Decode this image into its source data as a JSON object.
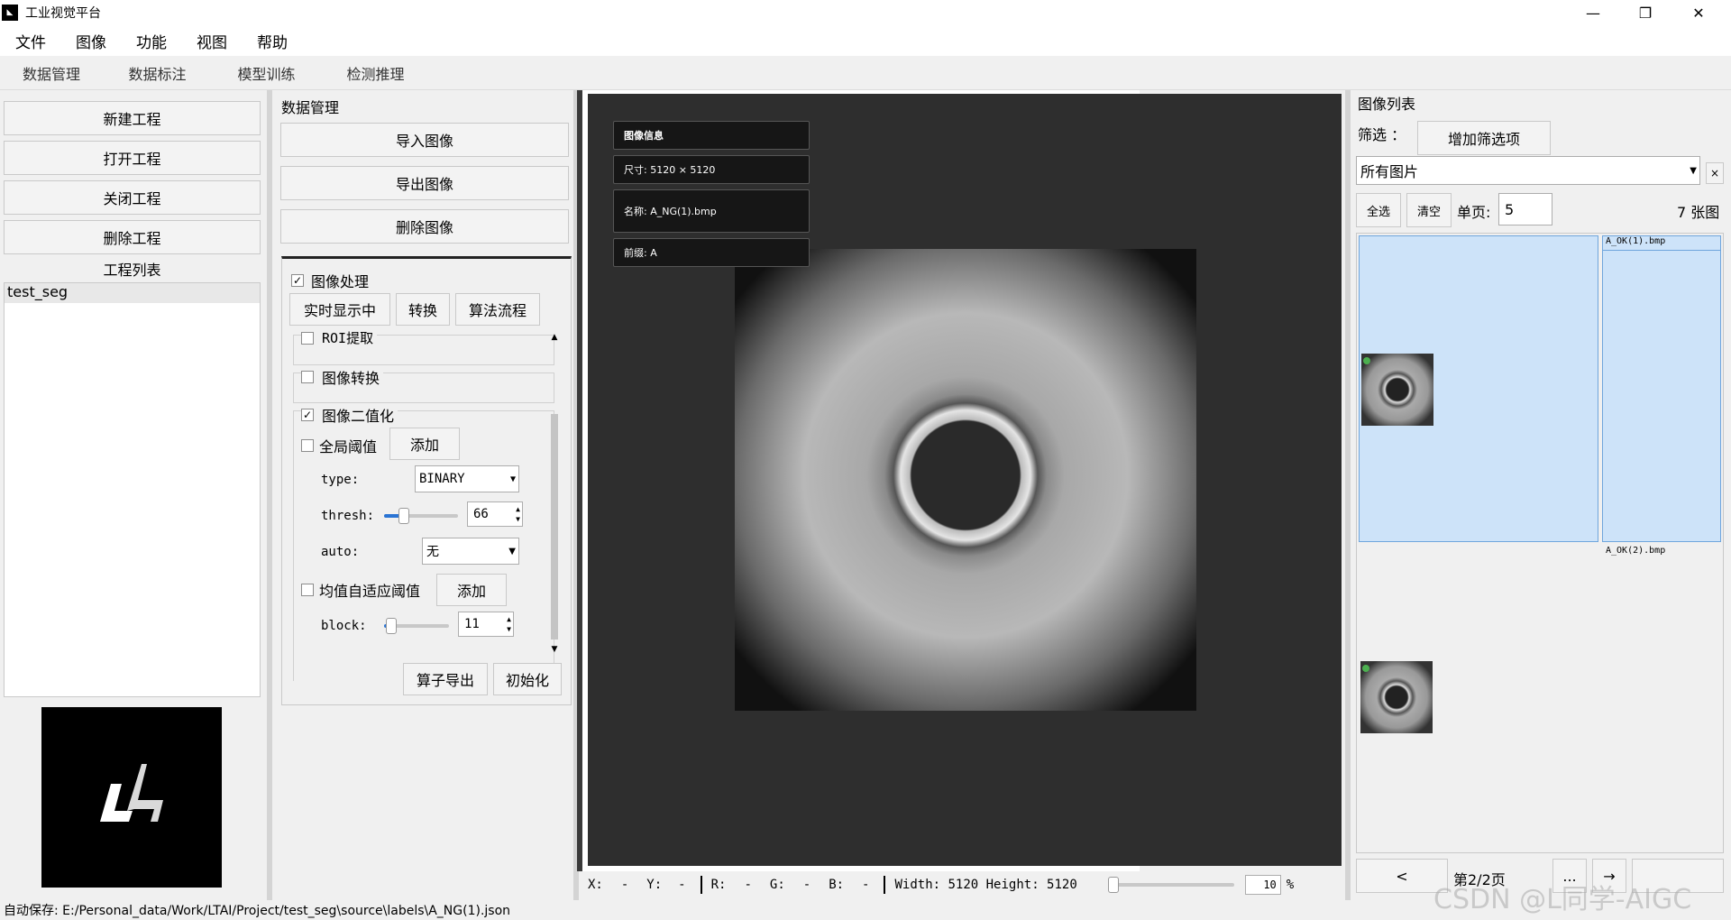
{
  "window": {
    "title": "工业视觉平台",
    "minimize": "—",
    "restore": "❐",
    "close": "✕"
  },
  "menu": [
    "文件",
    "图像",
    "功能",
    "视图",
    "帮助"
  ],
  "tabs": [
    "数据管理",
    "数据标注",
    "模型训练",
    "检测推理"
  ],
  "left": {
    "buttons": [
      "新建工程",
      "打开工程",
      "关闭工程",
      "删除工程"
    ],
    "project_list_label": "工程列表",
    "projects": [
      "test_seg"
    ]
  },
  "data_panel": {
    "title": "数据管理",
    "buttons": [
      "导入图像",
      "导出图像",
      "删除图像"
    ],
    "image_processing": {
      "label": "图像处理",
      "checked": true,
      "buttons": [
        "实时显示中",
        "转换",
        "算法流程"
      ],
      "roi": {
        "label": "ROI提取",
        "checked": false
      },
      "convert": {
        "label": "图像转换",
        "checked": false
      },
      "binarize": {
        "label": "图像二值化",
        "checked": true,
        "global": {
          "label": "全局阈值",
          "checked": false,
          "add": "添加"
        },
        "type_label": "type:",
        "type_value": "BINARY",
        "thresh_label": "thresh:",
        "thresh_value": "66",
        "auto_label": "auto:",
        "auto_value": "无",
        "adaptive": {
          "label": "均值自适应阈值",
          "checked": false,
          "add": "添加"
        },
        "block_label": "block:",
        "block_value": "11"
      },
      "export": "算子导出",
      "init": "初始化"
    }
  },
  "image_info": {
    "title": "图像信息",
    "size": "尺寸: 5120 × 5120",
    "name": "名称: A_NG(1).bmp",
    "prefix": "前缀: A"
  },
  "pixel_status": {
    "x": "X:",
    "x_val": "-",
    "y": "Y:",
    "y_val": "-",
    "r": "R:",
    "r_val": "-",
    "g": "G:",
    "g_val": "-",
    "b": "B:",
    "b_val": "-",
    "dims": "Width: 5120 Height: 5120",
    "zoom": "10",
    "zoom_unit": "%"
  },
  "image_list": {
    "title": "图像列表",
    "filter_label": "筛选 ：",
    "add_filter": "增加筛选项",
    "filter_value": "所有图片",
    "clear_filter": "×",
    "select_all": "全选",
    "clear": "清空",
    "per_page_label": "单页:",
    "per_page": "5",
    "total": "7 张图",
    "items": [
      "A_OK(1).bmp",
      "A_OK(2).bmp"
    ],
    "prev": "<",
    "page": "第2/2页",
    "more": "...",
    "next": "→"
  },
  "status_bar": "自动保存: E:/Personal_data/Work/LTAI/Project/test_seg\\source\\labels\\A_NG(1).json",
  "watermark": "CSDN @L同学-AIGC"
}
